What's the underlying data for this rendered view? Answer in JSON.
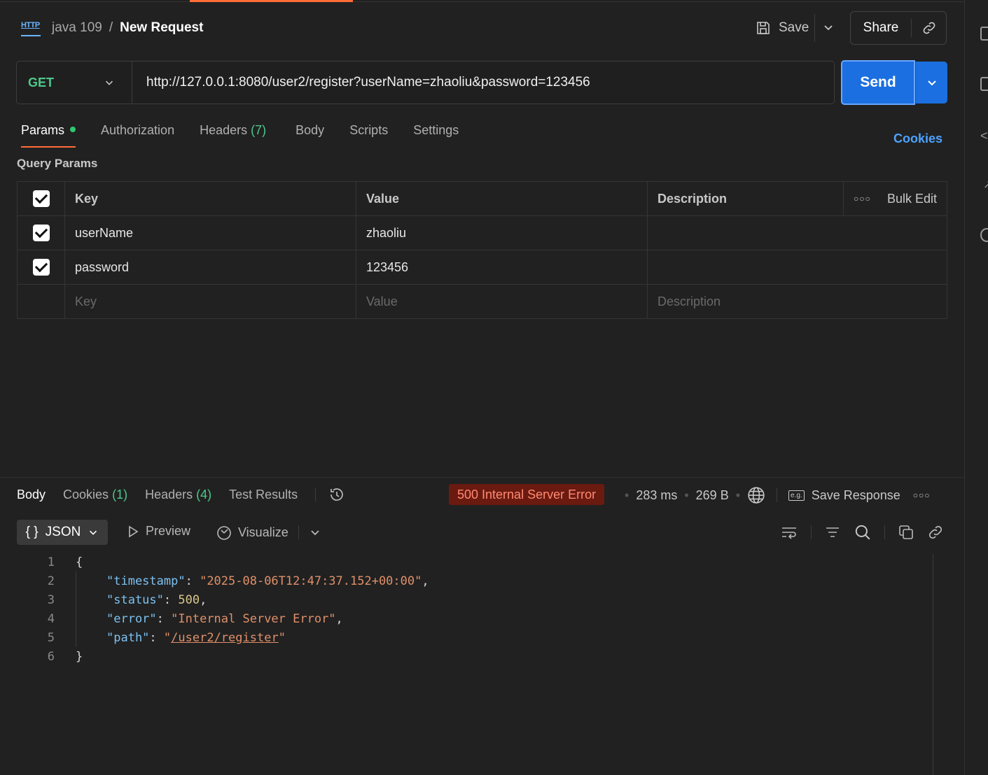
{
  "header": {
    "breadcrumb_parent": "java 109",
    "breadcrumb_sep": "/",
    "request_name": "New Request",
    "http_badge": "HTTP",
    "save_label": "Save",
    "share_label": "Share"
  },
  "request": {
    "method": "GET",
    "url": "http://127.0.0.1:8080/user2/register?userName=zhaoliu&password=123456",
    "send_label": "Send"
  },
  "tabs": {
    "params": "Params",
    "authorization": "Authorization",
    "headers": "Headers",
    "headers_count": "(7)",
    "body": "Body",
    "scripts": "Scripts",
    "settings": "Settings",
    "cookies": "Cookies"
  },
  "query_params": {
    "title": "Query Params",
    "columns": {
      "key": "Key",
      "value": "Value",
      "description": "Description",
      "bulk_edit": "Bulk Edit"
    },
    "rows": [
      {
        "key": "userName",
        "value": "zhaoliu",
        "description": ""
      },
      {
        "key": "password",
        "value": "123456",
        "description": ""
      }
    ],
    "placeholders": {
      "key": "Key",
      "value": "Value",
      "description": "Description"
    }
  },
  "response": {
    "tabs": {
      "body": "Body",
      "cookies": "Cookies",
      "cookies_count": "(1)",
      "headers": "Headers",
      "headers_count": "(4)",
      "test_results": "Test Results"
    },
    "status": "500 Internal Server Error",
    "time": "283 ms",
    "size": "269 B",
    "save_response": "Save Response",
    "format": "JSON",
    "preview": "Preview",
    "visualize": "Visualize",
    "status_color": "#6b1a10",
    "line_numbers": [
      "1",
      "2",
      "3",
      "4",
      "5",
      "6"
    ],
    "json": {
      "timestamp_key": "\"timestamp\"",
      "timestamp_val": "\"2025-08-06T12:47:37.152+00:00\"",
      "status_key": "\"status\"",
      "status_val": "500",
      "error_key": "\"error\"",
      "error_val": "\"Internal Server Error\"",
      "path_key": "\"path\"",
      "path_val": "/user2/register"
    }
  },
  "colors": {
    "accent": "#ff6c37",
    "send": "#1b6fe0",
    "link": "#4da3ff",
    "method": "#4dc88a"
  }
}
